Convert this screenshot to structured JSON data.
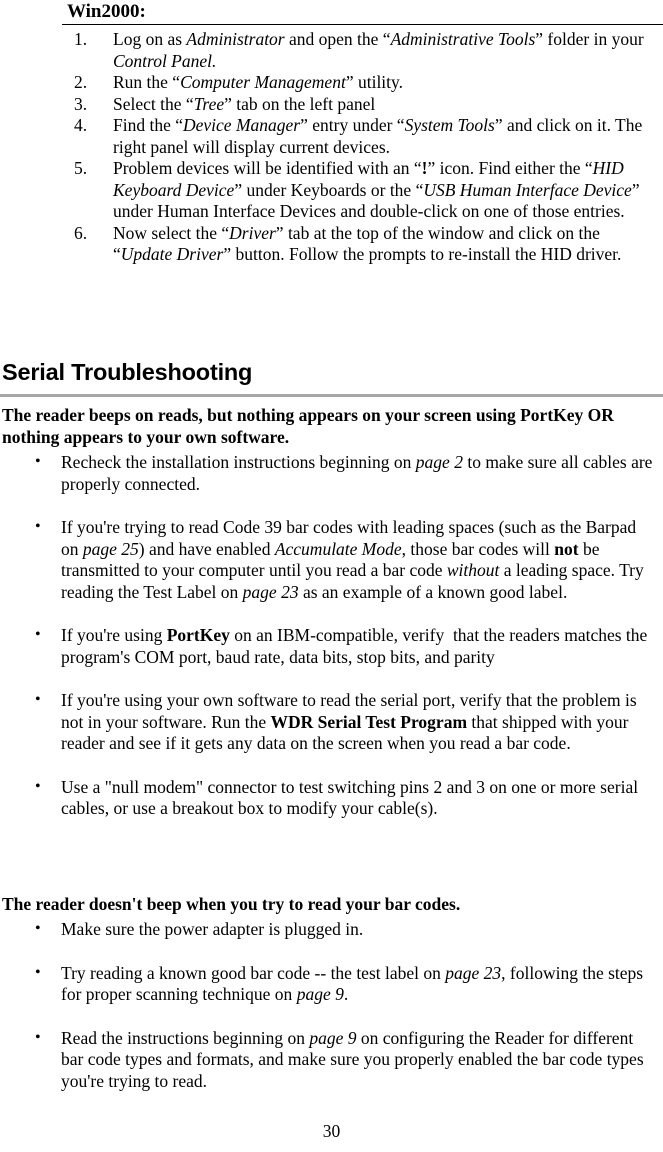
{
  "win2000": {
    "heading": "Win2000:",
    "steps": [
      {
        "num": "1.",
        "html": "Log on as <i>Administrator</i> and open the “<i>Administrative Tools</i>” folder in your <i>Control Panel.</i>"
      },
      {
        "num": "2.",
        "html": "Run the “<i>Computer Management</i>” utility."
      },
      {
        "num": "3.",
        "html": "Select the “<i>Tree</i>” tab on the left panel"
      },
      {
        "num": "4.",
        "html": "Find the “<i>Device Manager</i>” entry under “<i>System Tools</i>” and click on it. The right panel will display current devices."
      },
      {
        "num": "5.",
        "html": "Problem devices will be identified with an “<b>!</b>” icon. Find either the “<i>HID Keyboard Device</i>” under Keyboards or the “<i>USB Human Interface Device</i>” under Human Interface Devices and double-click on one of those entries."
      },
      {
        "num": "6.",
        "html": "Now select the “<i>Driver</i>” tab at the top of the window and click on the “<i>Update Driver</i>” button. Follow the prompts to re-install the HID driver."
      }
    ]
  },
  "serial_section": {
    "heading": "Serial Troubleshooting",
    "question_1": "The reader beeps on reads, but nothing appears on your screen using PortKey OR nothing appears to your own software.",
    "bullets_1": [
      {
        "bullet": "•",
        "html": "Recheck the installation instructions beginning on <i>page 2</i> to make sure all cables are properly connected."
      },
      {
        "bullet": "•",
        "html": "If you're trying to read Code 39 bar codes with leading spaces (such as the Barpad on <i>page 25</i>) and have enabled <i>Accumulate Mode</i>, those bar codes will <b>not</b> be transmitted to your computer until you read a bar code <i>without</i> a leading space. Try reading the Test Label on <i>page 23</i> as an example of a known good label."
      },
      {
        "bullet": "•",
        "html": "If you're using <b>PortKey</b> on an IBM-compatible, verify&nbsp; that the readers matches the program's COM port, baud rate, data bits, stop bits, and parity"
      },
      {
        "bullet": "•",
        "html": "If you're using your own software to read the serial port, verify that the problem is not in your software. Run the <b>WDR Serial Test Program</b> that shipped with your reader and see if it gets any data on the screen when you read a bar code."
      },
      {
        "bullet": "•",
        "html": "Use a \"null modem\" connector to test switching pins 2 and 3 on one or more serial cables, or use a breakout box to modify your cable(s)."
      }
    ],
    "question_2": "The reader doesn't beep when you try to read your bar codes.",
    "bullets_2": [
      {
        "bullet": "•",
        "html": "Make sure the power adapter is plugged in."
      },
      {
        "bullet": "•",
        "html": "Try reading a known good bar code -- the test label on <i>page 23</i>, following the steps for proper scanning technique on <i>page 9</i>."
      },
      {
        "bullet": "•",
        "html": "Read the instructions beginning on <i>page 9</i> on configuring the Reader for different bar code types and formats, and make sure you properly enabled the bar code types you're trying to read."
      }
    ]
  },
  "footer": {
    "page_number": "30"
  },
  "colors": {
    "text": "#000000",
    "thin_rule": "#000000",
    "gray_rule": "#a6a6a6",
    "background": "#ffffff"
  }
}
